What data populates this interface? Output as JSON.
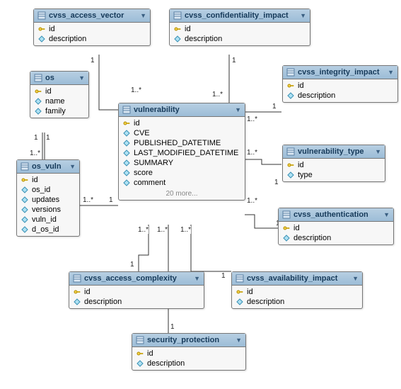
{
  "tables": {
    "cvss_access_vector": {
      "title": "cvss_access_vector",
      "cols": [
        {
          "n": "id",
          "t": "pk"
        },
        {
          "n": "description",
          "t": "attr"
        }
      ]
    },
    "cvss_confidentiality_impact": {
      "title": "cvss_confidentiality_impact",
      "cols": [
        {
          "n": "id",
          "t": "pk"
        },
        {
          "n": "description",
          "t": "attr"
        }
      ]
    },
    "os": {
      "title": "os",
      "cols": [
        {
          "n": "id",
          "t": "pk"
        },
        {
          "n": "name",
          "t": "attr"
        },
        {
          "n": "family",
          "t": "attr"
        }
      ]
    },
    "cvss_integrity_impact": {
      "title": "cvss_integrity_impact",
      "cols": [
        {
          "n": "id",
          "t": "pk"
        },
        {
          "n": "description",
          "t": "attr"
        }
      ]
    },
    "vulnerability": {
      "title": "vulnerability",
      "cols": [
        {
          "n": "id",
          "t": "pk"
        },
        {
          "n": "CVE",
          "t": "attr"
        },
        {
          "n": "PUBLISHED_DATETIME",
          "t": "attr"
        },
        {
          "n": "LAST_MODIFIED_DATETIME",
          "t": "attr"
        },
        {
          "n": "SUMMARY",
          "t": "attr"
        },
        {
          "n": "score",
          "t": "attr"
        },
        {
          "n": "comment",
          "t": "attr"
        }
      ],
      "more": "20 more..."
    },
    "vulnerability_type": {
      "title": "vulnerability_type",
      "cols": [
        {
          "n": "id",
          "t": "pk"
        },
        {
          "n": "type",
          "t": "attr"
        }
      ]
    },
    "os_vuln": {
      "title": "os_vuln",
      "cols": [
        {
          "n": "id",
          "t": "pk"
        },
        {
          "n": "os_id",
          "t": "attr"
        },
        {
          "n": "updates",
          "t": "attr"
        },
        {
          "n": "versions",
          "t": "attr"
        },
        {
          "n": "vuln_id",
          "t": "attr"
        },
        {
          "n": "d_os_id",
          "t": "attr"
        }
      ]
    },
    "cvss_authentication": {
      "title": "cvss_authentication",
      "cols": [
        {
          "n": "id",
          "t": "pk"
        },
        {
          "n": "description",
          "t": "attr"
        }
      ]
    },
    "cvss_access_complexity": {
      "title": "cvss_access_complexity",
      "cols": [
        {
          "n": "id",
          "t": "pk"
        },
        {
          "n": "description",
          "t": "attr"
        }
      ]
    },
    "cvss_availability_impact": {
      "title": "cvss_availability_impact",
      "cols": [
        {
          "n": "id",
          "t": "pk"
        },
        {
          "n": "description",
          "t": "attr"
        }
      ]
    },
    "security_protection": {
      "title": "security_protection",
      "cols": [
        {
          "n": "id",
          "t": "pk"
        },
        {
          "n": "description",
          "t": "attr"
        }
      ]
    }
  },
  "cardinalities": {
    "one": "1",
    "many": "1..*"
  },
  "relations": [
    {
      "from": "cvss_access_vector",
      "to": "vulnerability",
      "from_c": "1",
      "to_c": "1..*"
    },
    {
      "from": "cvss_confidentiality_impact",
      "to": "vulnerability",
      "from_c": "1",
      "to_c": "1..*"
    },
    {
      "from": "cvss_integrity_impact",
      "to": "vulnerability",
      "from_c": "1",
      "to_c": "1..*"
    },
    {
      "from": "vulnerability_type",
      "to": "vulnerability",
      "from_c": "1",
      "to_c": "1..*"
    },
    {
      "from": "cvss_authentication",
      "to": "vulnerability",
      "from_c": "1",
      "to_c": "1..*"
    },
    {
      "from": "cvss_availability_impact",
      "to": "vulnerability",
      "from_c": "1",
      "to_c": "1..*"
    },
    {
      "from": "cvss_access_complexity",
      "to": "vulnerability",
      "from_c": "1",
      "to_c": "1..*"
    },
    {
      "from": "security_protection",
      "to": "vulnerability",
      "from_c": "1",
      "to_c": "1..*"
    },
    {
      "from": "os",
      "to": "os_vuln",
      "from_c": "1",
      "to_c": "1..*"
    },
    {
      "from": "vulnerability",
      "to": "os_vuln",
      "from_c": "1",
      "to_c": "1..*"
    }
  ]
}
